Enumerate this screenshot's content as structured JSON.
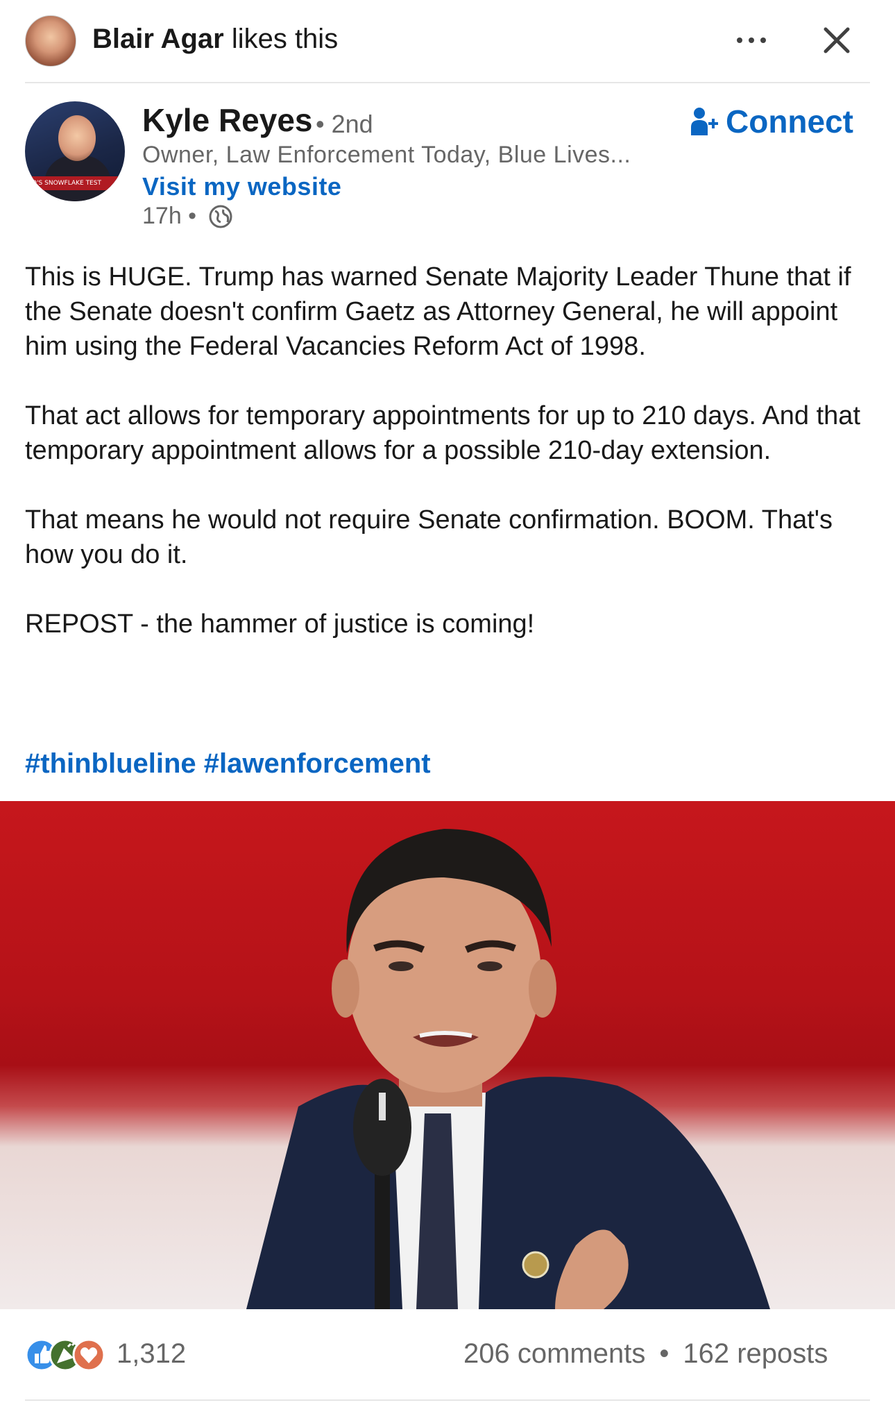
{
  "social_context": {
    "actor_name": "Blair Agar",
    "action": "likes this"
  },
  "author": {
    "name": "Kyle Reyes",
    "degree": "• 2nd",
    "headline": "Owner, Law Enforcement Today, Blue Lives...",
    "link_label": "Visit my website",
    "timestamp": "17h •",
    "visibility_icon": "globe-icon",
    "avatar_caption": "O'S SNOWFLAKE TEST"
  },
  "connect": {
    "label": "Connect",
    "icon": "add-person-icon"
  },
  "post": {
    "paragraphs": [
      "This is HUGE.  Trump has warned Senate Majority Leader Thune that if the Senate doesn't confirm Gaetz as Attorney General, he will appoint him using the Federal Vacancies Reform Act of 1998.",
      "That act allows for temporary appointments for up to 210 days. And that temporary appointment allows for a possible 210-day extension.",
      "That means he would not require Senate confirmation.  BOOM. That's how you do it.",
      "REPOST - the hammer of justice is coming!"
    ],
    "hashtags": "#thinblueline #lawenforcement"
  },
  "social_counts": {
    "reactions": "1,312",
    "comments": "206 comments",
    "separator": "•",
    "reposts": "162 reposts"
  },
  "colors": {
    "link_blue": "#0a66c2",
    "secondary_text": "#666666",
    "like_blue": "#378fe9",
    "celebrate_green": "#44712e",
    "love_red": "#df704d"
  }
}
